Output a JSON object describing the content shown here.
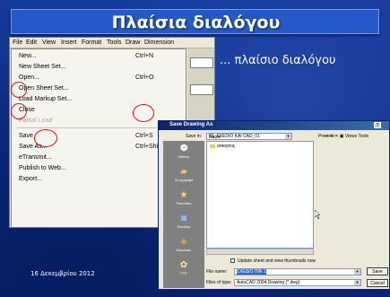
{
  "slide": {
    "title": "Πλαίσια διαλόγου",
    "subtitle": "... πλαίσιο διαλόγου",
    "date": "16 Δεκεμβρίου 2012"
  },
  "menubar": {
    "items": [
      "File",
      "Edit",
      "View",
      "Insert",
      "Format",
      "Tools",
      "Draw",
      "Dimension"
    ]
  },
  "file_menu": {
    "items": [
      {
        "label": "New...",
        "shortcut": "Ctrl+N"
      },
      {
        "label": "New Sheet Set...",
        "shortcut": ""
      },
      {
        "label": "Open...",
        "shortcut": "Ctrl+O"
      },
      {
        "label": "Open Sheet Set...",
        "shortcut": ""
      },
      {
        "label": "Load Markup Set...",
        "shortcut": ""
      },
      {
        "label": "Close",
        "shortcut": ""
      },
      {
        "label": "Partial Load",
        "shortcut": "",
        "disabled": true
      },
      {
        "label": "Save",
        "shortcut": "Ctrl+S"
      },
      {
        "label": "Save As...",
        "shortcut": "Ctrl+Shift"
      },
      {
        "label": "eTransmit...",
        "shortcut": ""
      },
      {
        "label": "Publish to Web...",
        "shortcut": ""
      },
      {
        "label": "Export...",
        "shortcut": ""
      }
    ]
  },
  "dialog": {
    "title": "Save Drawing As",
    "save_in_label": "Save in:",
    "save_in_value": "01_SXEDIO KAI CAD_01",
    "views_label": "Views",
    "tools_label": "Tools",
    "name_column": "Name",
    "preview_label": "Preview",
    "folder": "ασκησεις",
    "places": [
      "History",
      "Τα έγγραφά",
      "Favorites",
      "Desktop",
      "Buzzsaw",
      "FTP"
    ],
    "update_thumbnails_label": "Update sheet and view thumbnails now",
    "file_name_label": "File name:",
    "file_name_value": "ΣΧΕΔΙΟ ΠΙΝ 1",
    "file_type_label": "Files of type:",
    "file_type_value": "AutoCAD 2004 Drawing (*.dwg)",
    "save_button": "Save",
    "cancel_button": "Cancel",
    "help_glyph": "?"
  },
  "colors": {
    "highlight": "#e31414",
    "title_bar": "#2559c9",
    "slide_bg": "#0f2c82"
  }
}
